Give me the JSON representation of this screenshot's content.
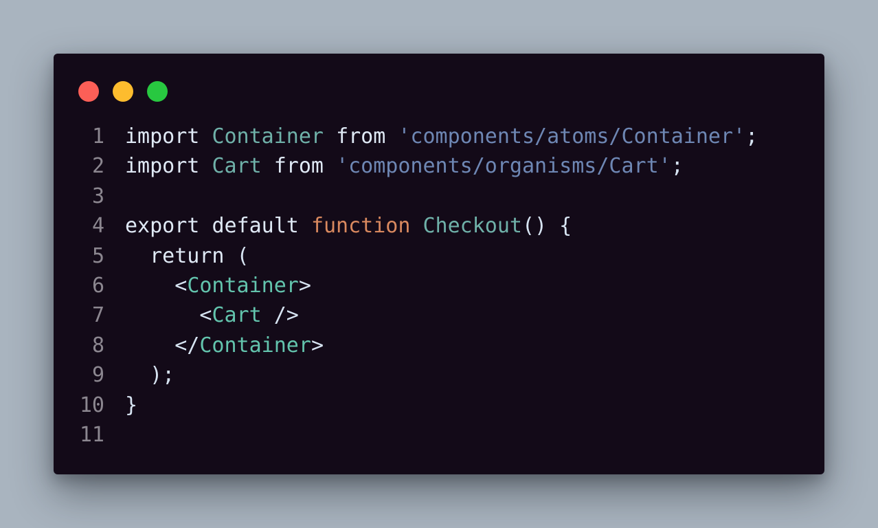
{
  "window": {
    "traffic_lights": [
      {
        "name": "close",
        "color": "#fc5f57"
      },
      {
        "name": "minimize",
        "color": "#fdbc2e"
      },
      {
        "name": "zoom",
        "color": "#28c840"
      }
    ]
  },
  "colors": {
    "background": "#a9b4bf",
    "editor_background": "#130a18",
    "line_number": "#8c8790",
    "keyword": "#dfe9f5",
    "identifier": "#6fb1a9",
    "string": "#6e87b4",
    "function_keyword": "#d9895f",
    "jsx_tag": "#63c4ad"
  },
  "code": {
    "lines": [
      {
        "number": "1",
        "tokens": [
          {
            "text": "import",
            "kind": "kw"
          },
          {
            "text": " ",
            "kind": "punct"
          },
          {
            "text": "Container",
            "kind": "ident"
          },
          {
            "text": " ",
            "kind": "punct"
          },
          {
            "text": "from",
            "kind": "kw"
          },
          {
            "text": " ",
            "kind": "punct"
          },
          {
            "text": "'components/atoms/Container'",
            "kind": "str"
          },
          {
            "text": ";",
            "kind": "punct"
          }
        ]
      },
      {
        "number": "2",
        "tokens": [
          {
            "text": "import",
            "kind": "kw"
          },
          {
            "text": " ",
            "kind": "punct"
          },
          {
            "text": "Cart",
            "kind": "ident"
          },
          {
            "text": " ",
            "kind": "punct"
          },
          {
            "text": "from",
            "kind": "kw"
          },
          {
            "text": " ",
            "kind": "punct"
          },
          {
            "text": "'components/organisms/Cart'",
            "kind": "str"
          },
          {
            "text": ";",
            "kind": "punct"
          }
        ]
      },
      {
        "number": "3",
        "tokens": []
      },
      {
        "number": "4",
        "tokens": [
          {
            "text": "export",
            "kind": "kw"
          },
          {
            "text": " ",
            "kind": "punct"
          },
          {
            "text": "default",
            "kind": "kw"
          },
          {
            "text": " ",
            "kind": "punct"
          },
          {
            "text": "function",
            "kind": "fn"
          },
          {
            "text": " ",
            "kind": "punct"
          },
          {
            "text": "Checkout",
            "kind": "ident"
          },
          {
            "text": "() {",
            "kind": "punct"
          }
        ]
      },
      {
        "number": "5",
        "tokens": [
          {
            "text": "  ",
            "kind": "punct"
          },
          {
            "text": "return",
            "kind": "kw"
          },
          {
            "text": " (",
            "kind": "punct"
          }
        ]
      },
      {
        "number": "6",
        "tokens": [
          {
            "text": "    <",
            "kind": "punct"
          },
          {
            "text": "Container",
            "kind": "tag"
          },
          {
            "text": ">",
            "kind": "punct"
          }
        ]
      },
      {
        "number": "7",
        "tokens": [
          {
            "text": "      <",
            "kind": "punct"
          },
          {
            "text": "Cart",
            "kind": "tag"
          },
          {
            "text": " />",
            "kind": "punct"
          }
        ]
      },
      {
        "number": "8",
        "tokens": [
          {
            "text": "    </",
            "kind": "punct"
          },
          {
            "text": "Container",
            "kind": "tag"
          },
          {
            "text": ">",
            "kind": "punct"
          }
        ]
      },
      {
        "number": "9",
        "tokens": [
          {
            "text": "  );",
            "kind": "punct"
          }
        ]
      },
      {
        "number": "10",
        "tokens": [
          {
            "text": "}",
            "kind": "punct"
          }
        ]
      },
      {
        "number": "11",
        "tokens": []
      }
    ]
  }
}
